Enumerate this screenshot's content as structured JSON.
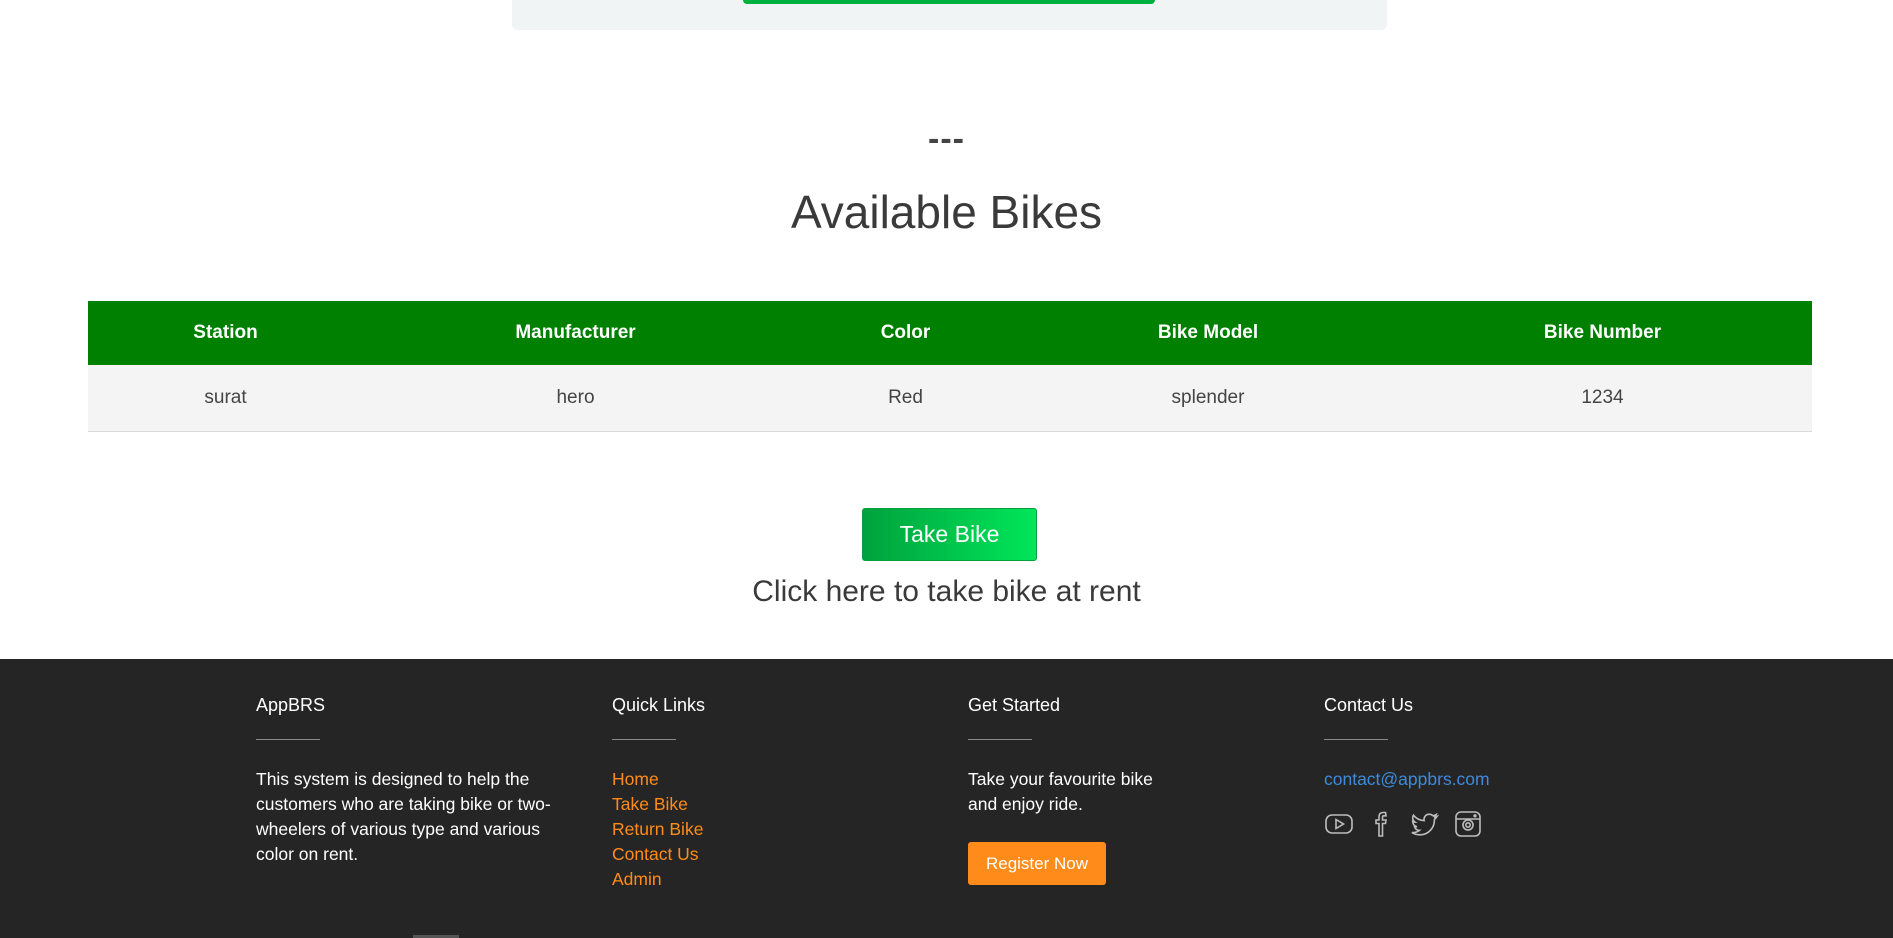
{
  "section": {
    "divider": "---",
    "title": "Available Bikes"
  },
  "table": {
    "headers": [
      "Station",
      "Manufacturer",
      "Color",
      "Bike Model",
      "Bike Number"
    ],
    "rows": [
      [
        "surat",
        "hero",
        "Red",
        "splender",
        "1234"
      ]
    ]
  },
  "cta": {
    "button_label": "Take Bike",
    "caption": "Click here to take bike at rent"
  },
  "footer": {
    "about": {
      "heading": "AppBRS",
      "text": "This system is designed to help the customers who are taking bike or two-wheelers of various type and various color on rent."
    },
    "quick_links": {
      "heading": "Quick Links",
      "items": [
        "Home",
        "Take Bike",
        "Return Bike",
        "Contact Us",
        "Admin"
      ]
    },
    "get_started": {
      "heading": "Get Started",
      "text": "Take your favourite bike and enjoy ride.",
      "button_label": "Register Now"
    },
    "contact": {
      "heading": "Contact Us",
      "email": "contact@appbrs.com",
      "socials": [
        "youtube-icon",
        "facebook-icon",
        "twitter-icon",
        "instagram-icon"
      ]
    }
  },
  "colors": {
    "table_header": "#008000",
    "primary_button": "#00b140",
    "accent_orange": "#ff8c1a",
    "footer_bg": "#252525",
    "link_blue": "#3d8bd9"
  }
}
